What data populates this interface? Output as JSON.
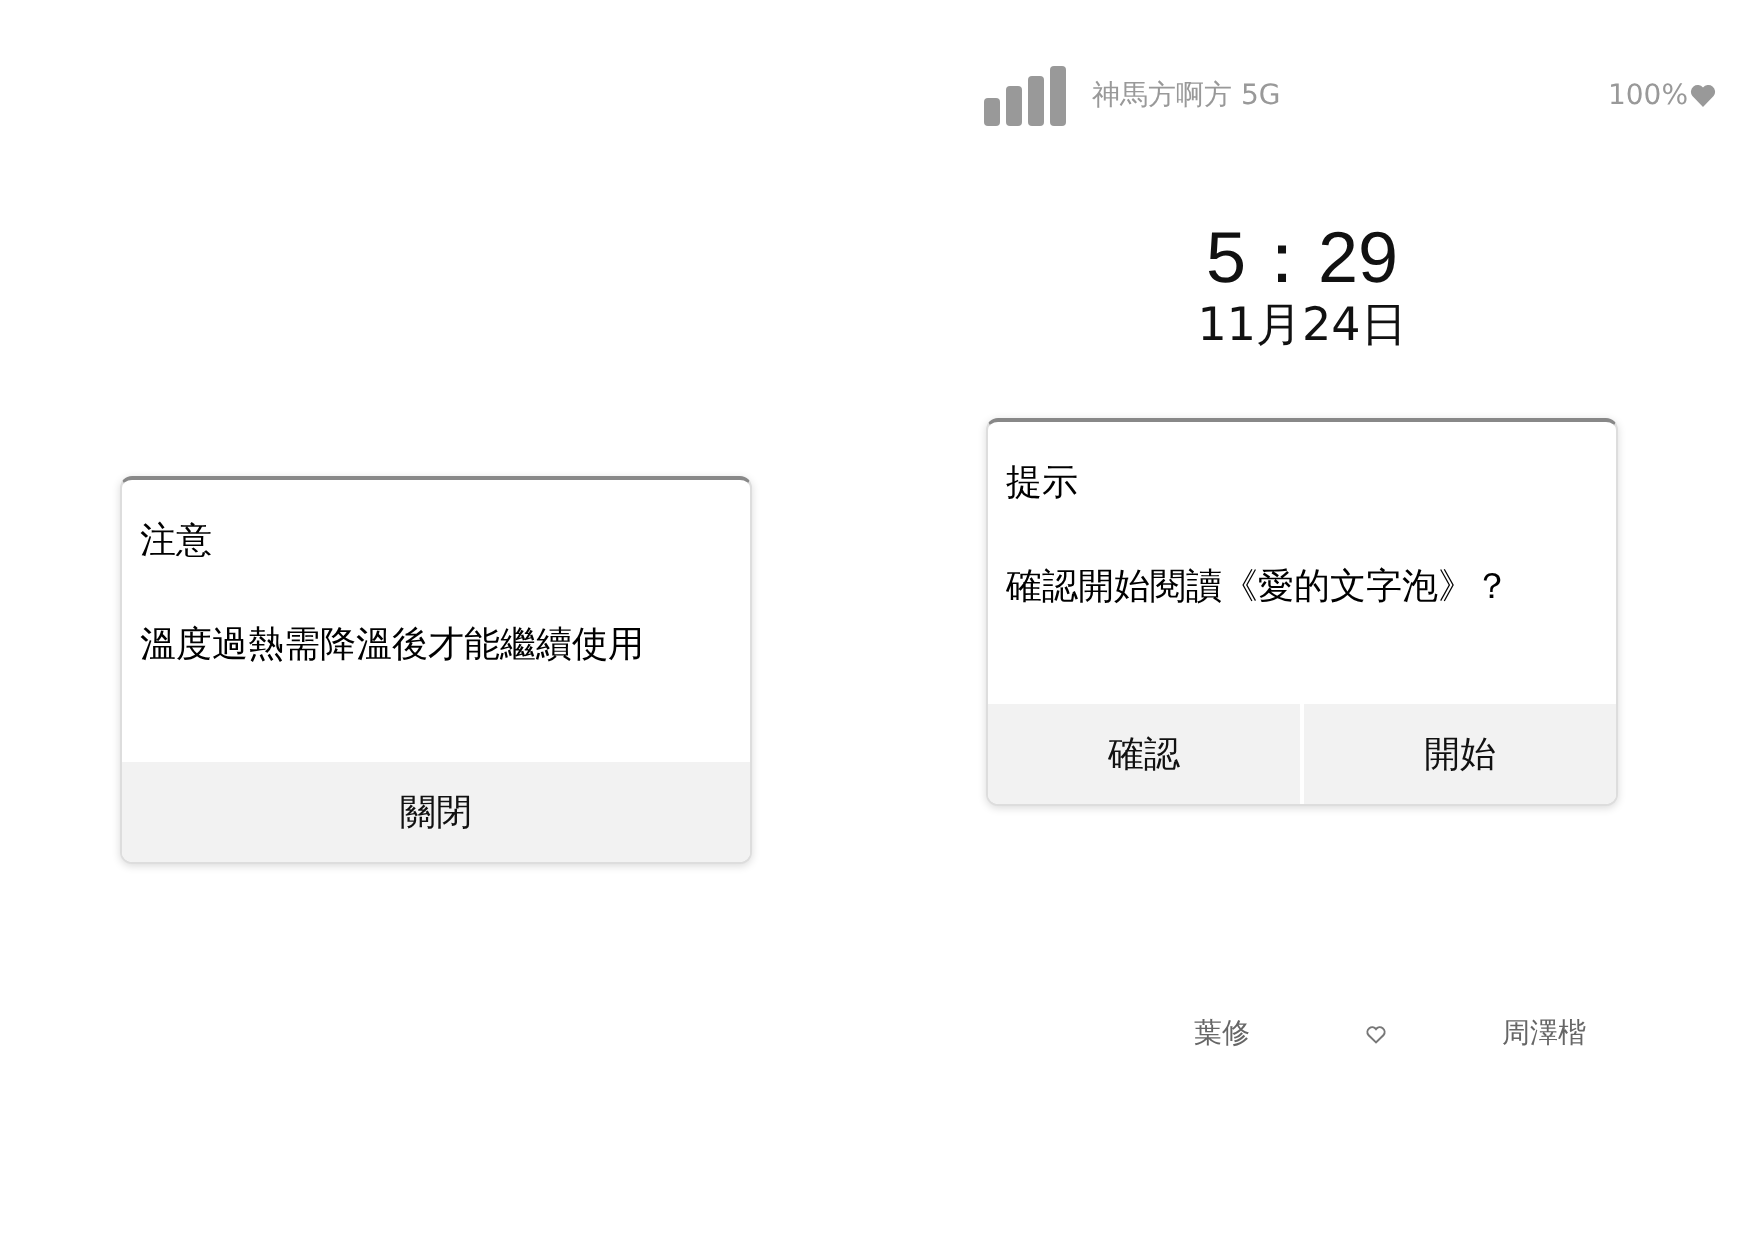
{
  "status_bar": {
    "carrier": "神馬方啊方 5G",
    "battery": "100%"
  },
  "clock": {
    "time": "5：29",
    "date": "11月24日"
  },
  "dialogs": [
    {
      "title": "注意",
      "message": "溫度過熱需降溫後才能繼續使用",
      "buttons": [
        "關閉"
      ]
    },
    {
      "title": "提示",
      "message": "確認開始閱讀《愛的文字泡》？",
      "buttons": [
        "確認",
        "開始"
      ]
    }
  ],
  "footer": {
    "left": "葉修",
    "right": "周澤楷"
  }
}
